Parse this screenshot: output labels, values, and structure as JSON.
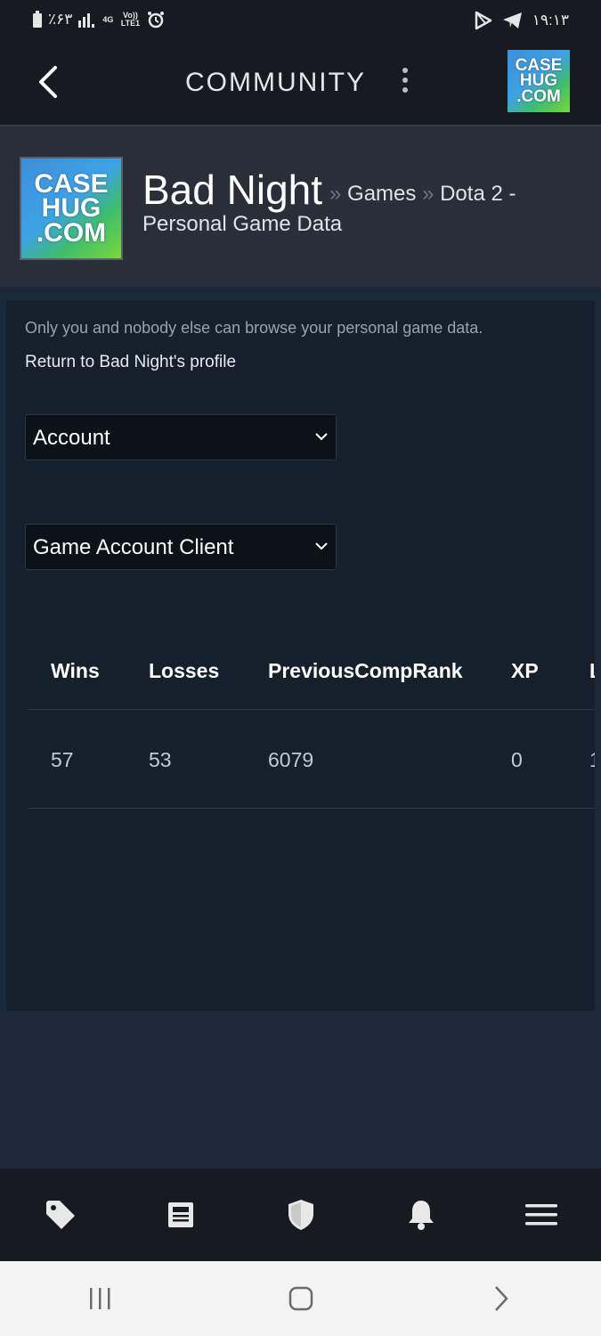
{
  "status_bar": {
    "left_text": "٪۶۳",
    "network_label": "4G",
    "volte_label": "Vo)) LTE1",
    "time": "۱۹:۱۳"
  },
  "header": {
    "title": "COMMUNITY",
    "logo_lines": [
      "CASE",
      "HUG",
      ".COM"
    ]
  },
  "profile": {
    "persona_name": "Bad Night",
    "crumb_sep": "»",
    "crumb_games": "Games",
    "crumb_game": "Dota 2 -",
    "crumb_page": "Personal Game Data",
    "avatar_lines": [
      "CASE",
      "HUG",
      ".COM"
    ]
  },
  "content": {
    "privacy_note": "Only you and nobody else can browse your personal game data.",
    "return_link": "Return to Bad Night's profile",
    "dropdown_category": "Account",
    "dropdown_table": "Game Account Client"
  },
  "stats_table": {
    "columns": [
      "Wins",
      "Losses",
      "PreviousCompRank",
      "XP",
      "L"
    ],
    "rows": [
      [
        "57",
        "53",
        "6079",
        "0",
        "1"
      ]
    ]
  },
  "bottom_nav": {
    "items": [
      "store-tag-icon",
      "news-icon",
      "shield-icon",
      "bell-icon",
      "menu-icon"
    ]
  },
  "colors": {
    "background": "#1b2838",
    "header_bg": "#171a21",
    "profile_band": "#2a2e38",
    "panel": "#16202d"
  }
}
